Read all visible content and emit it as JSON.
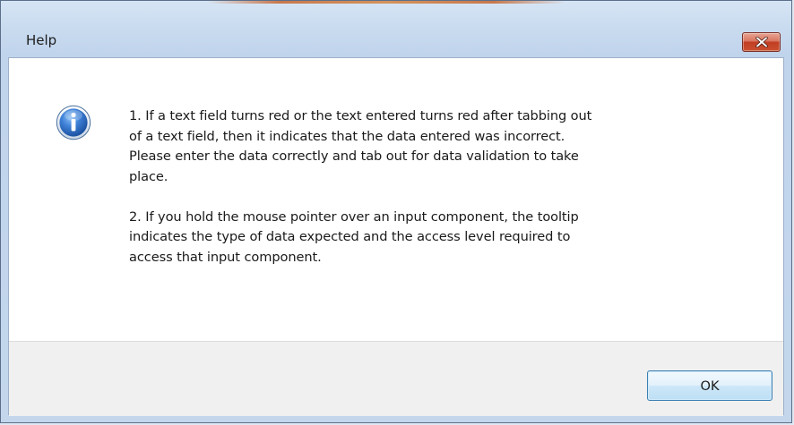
{
  "window": {
    "title": "Help"
  },
  "message": {
    "paragraphs": [
      "1. If a text field turns red or the text entered turns red after tabbing out\nof a text field, then it indicates that the data entered was incorrect.\nPlease enter the data correctly and tab out for data validation to take\nplace.",
      "2. If you hold the mouse pointer over an input component, the tooltip\nindicates the type of data expected and the access level required to\naccess that input component."
    ]
  },
  "buttons": {
    "ok_label": "OK"
  },
  "icons": {
    "dialog_icon": "information-icon",
    "close_icon": "close-x-icon"
  },
  "colors": {
    "close_button": "#c9512f",
    "ok_border": "#3c7fb1",
    "info_icon": "#2f6bc4"
  }
}
